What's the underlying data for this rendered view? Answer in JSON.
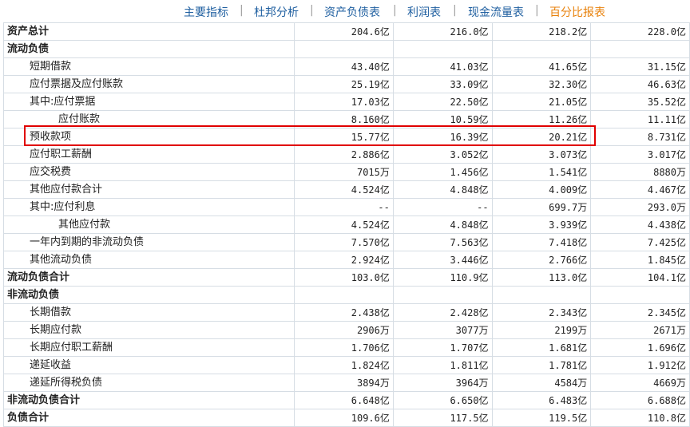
{
  "nav": {
    "tabs": [
      {
        "label": "主要指标"
      },
      {
        "label": "杜邦分析"
      },
      {
        "label": "资产负债表"
      },
      {
        "label": "利润表"
      },
      {
        "label": "现金流量表"
      },
      {
        "label": "百分比报表"
      }
    ],
    "separator": "|",
    "active_tab": "百分比报表"
  },
  "table": {
    "rows": [
      {
        "label": "资产总计",
        "indent": 0,
        "bold": true,
        "values": [
          "204.6亿",
          "216.0亿",
          "218.2亿",
          "228.0亿"
        ]
      },
      {
        "label": "流动负债",
        "indent": 0,
        "bold": true,
        "values": [
          "",
          "",
          "",
          ""
        ]
      },
      {
        "label": "短期借款",
        "indent": 1,
        "bold": false,
        "values": [
          "43.40亿",
          "41.03亿",
          "41.65亿",
          "31.15亿"
        ]
      },
      {
        "label": "应付票据及应付账款",
        "indent": 1,
        "bold": false,
        "values": [
          "25.19亿",
          "33.09亿",
          "32.30亿",
          "46.63亿"
        ]
      },
      {
        "label": "其中:应付票据",
        "indent": 1,
        "bold": false,
        "values": [
          "17.03亿",
          "22.50亿",
          "21.05亿",
          "35.52亿"
        ]
      },
      {
        "label": "应付账款",
        "indent": 2,
        "bold": false,
        "values": [
          "8.160亿",
          "10.59亿",
          "11.26亿",
          "11.11亿"
        ]
      },
      {
        "label": "预收款项",
        "indent": 1,
        "bold": false,
        "highlight": true,
        "values": [
          "15.77亿",
          "16.39亿",
          "20.21亿",
          "8.731亿"
        ]
      },
      {
        "label": "应付职工薪酬",
        "indent": 1,
        "bold": false,
        "values": [
          "2.886亿",
          "3.052亿",
          "3.073亿",
          "3.017亿"
        ]
      },
      {
        "label": "应交税费",
        "indent": 1,
        "bold": false,
        "values": [
          "7015万",
          "1.456亿",
          "1.541亿",
          "8880万"
        ]
      },
      {
        "label": "其他应付款合计",
        "indent": 1,
        "bold": false,
        "values": [
          "4.524亿",
          "4.848亿",
          "4.009亿",
          "4.467亿"
        ]
      },
      {
        "label": "其中:应付利息",
        "indent": 1,
        "bold": false,
        "values": [
          "--",
          "--",
          "699.7万",
          "293.0万"
        ]
      },
      {
        "label": "其他应付款",
        "indent": 2,
        "bold": false,
        "values": [
          "4.524亿",
          "4.848亿",
          "3.939亿",
          "4.438亿"
        ]
      },
      {
        "label": "一年内到期的非流动负债",
        "indent": 1,
        "bold": false,
        "values": [
          "7.570亿",
          "7.563亿",
          "7.418亿",
          "7.425亿"
        ]
      },
      {
        "label": "其他流动负债",
        "indent": 1,
        "bold": false,
        "values": [
          "2.924亿",
          "3.446亿",
          "2.766亿",
          "1.845亿"
        ]
      },
      {
        "label": "流动负债合计",
        "indent": 0,
        "bold": true,
        "values": [
          "103.0亿",
          "110.9亿",
          "113.0亿",
          "104.1亿"
        ]
      },
      {
        "label": "非流动负债",
        "indent": 0,
        "bold": true,
        "values": [
          "",
          "",
          "",
          ""
        ]
      },
      {
        "label": "长期借款",
        "indent": 1,
        "bold": false,
        "values": [
          "2.438亿",
          "2.428亿",
          "2.343亿",
          "2.345亿"
        ]
      },
      {
        "label": "长期应付款",
        "indent": 1,
        "bold": false,
        "values": [
          "2906万",
          "3077万",
          "2199万",
          "2671万"
        ]
      },
      {
        "label": "长期应付职工薪酬",
        "indent": 1,
        "bold": false,
        "values": [
          "1.706亿",
          "1.707亿",
          "1.681亿",
          "1.696亿"
        ]
      },
      {
        "label": "递延收益",
        "indent": 1,
        "bold": false,
        "values": [
          "1.824亿",
          "1.811亿",
          "1.781亿",
          "1.912亿"
        ]
      },
      {
        "label": "递延所得税负债",
        "indent": 1,
        "bold": false,
        "values": [
          "3894万",
          "3964万",
          "4584万",
          "4669万"
        ]
      },
      {
        "label": "非流动负债合计",
        "indent": 0,
        "bold": true,
        "values": [
          "6.648亿",
          "6.650亿",
          "6.483亿",
          "6.688亿"
        ]
      },
      {
        "label": "负债合计",
        "indent": 0,
        "bold": true,
        "values": [
          "109.6亿",
          "117.5亿",
          "119.5亿",
          "110.8亿"
        ]
      }
    ]
  },
  "colors": {
    "link": "#1f5fa0",
    "active": "#e8820c",
    "highlight": "#e00000",
    "border": "#d6dde4"
  }
}
